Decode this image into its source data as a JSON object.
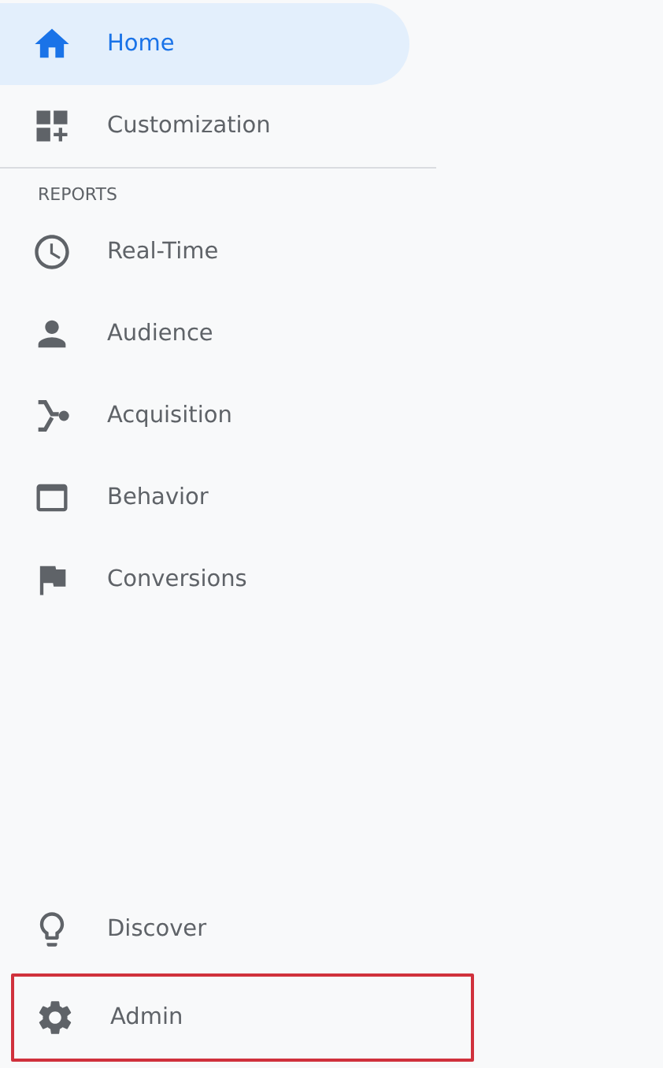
{
  "top_items": [
    {
      "label": "Home",
      "selected": true,
      "highlighted": false
    },
    {
      "label": "Customization",
      "selected": false,
      "highlighted": false
    }
  ],
  "reports": {
    "heading": "REPORTS",
    "items": [
      {
        "label": "Real-Time",
        "selected": false,
        "highlighted": false
      },
      {
        "label": "Audience",
        "selected": false,
        "highlighted": false
      },
      {
        "label": "Acquisition",
        "selected": false,
        "highlighted": false
      },
      {
        "label": "Behavior",
        "selected": false,
        "highlighted": false
      },
      {
        "label": "Conversions",
        "selected": false,
        "highlighted": false
      }
    ]
  },
  "bottom_items": [
    {
      "label": "Discover",
      "selected": false,
      "highlighted": false
    },
    {
      "label": "Admin",
      "selected": false,
      "highlighted": true
    }
  ]
}
